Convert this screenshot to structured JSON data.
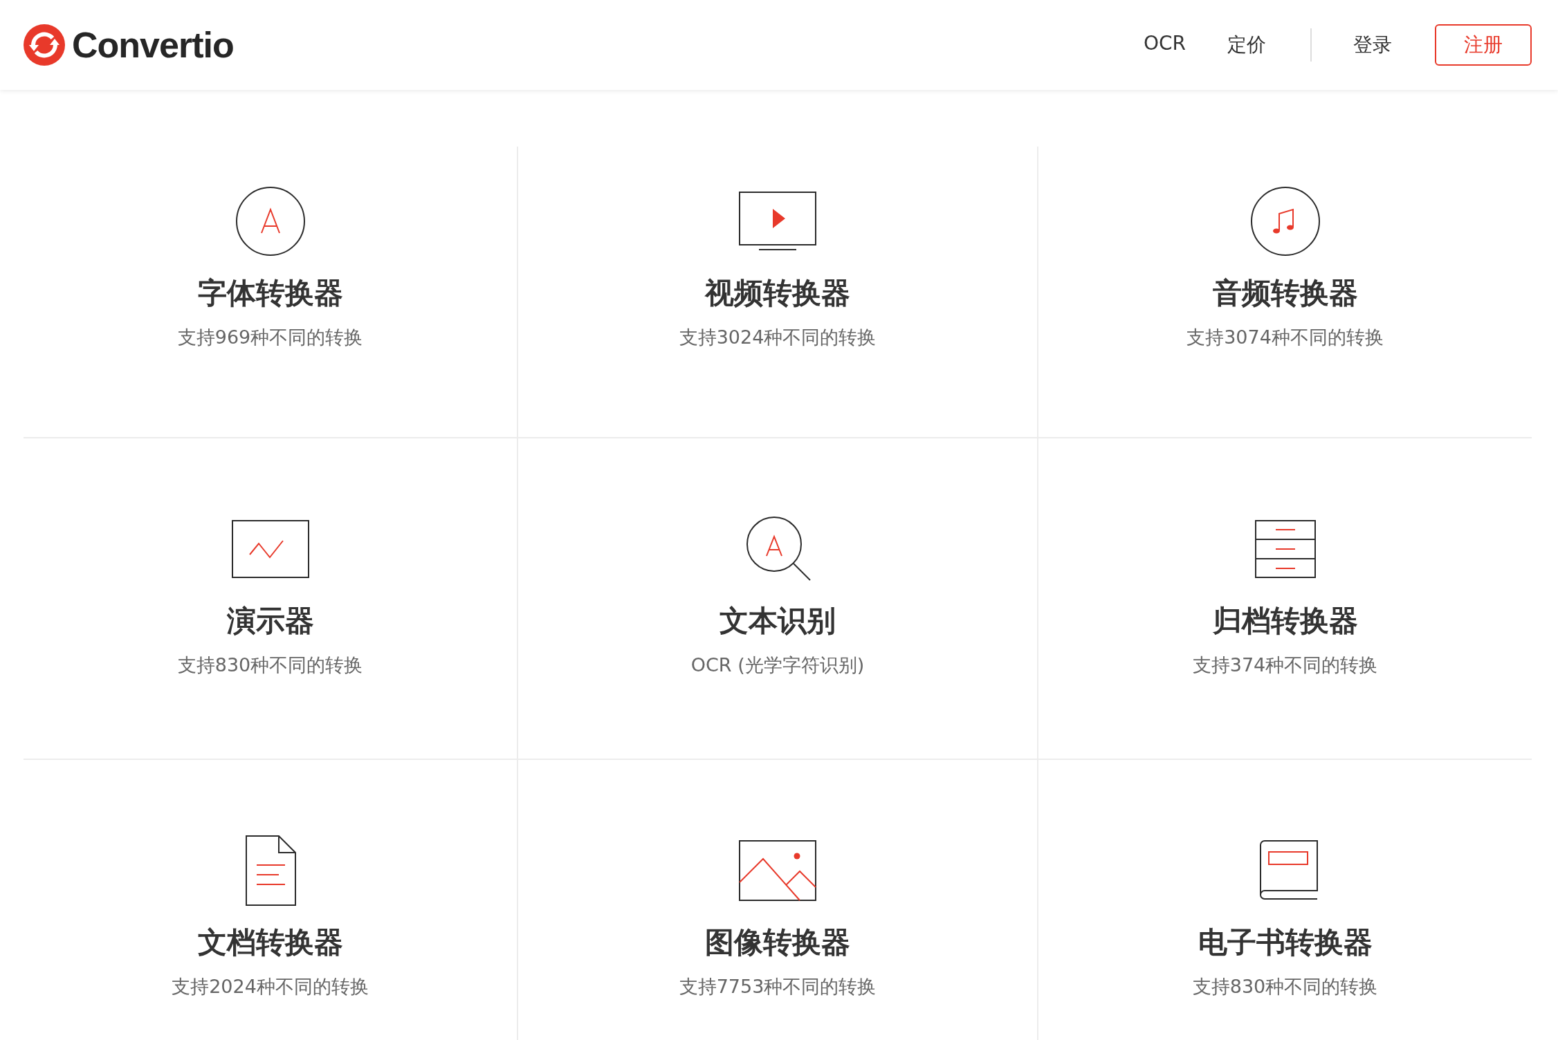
{
  "header": {
    "logo": "Convertio",
    "nav": [
      {
        "label": "OCR"
      },
      {
        "label": "定价"
      }
    ],
    "login": "登录",
    "signup": "注册"
  },
  "converters": [
    {
      "kind": "font",
      "title": "字体转换器",
      "subtitle": "支持969种不同的转换"
    },
    {
      "kind": "video",
      "title": "视频转换器",
      "subtitle": "支持3024种不同的转换"
    },
    {
      "kind": "audio",
      "title": "音频转换器",
      "subtitle": "支持3074种不同的转换"
    },
    {
      "kind": "presentation",
      "title": "演示器",
      "subtitle": "支持830种不同的转换"
    },
    {
      "kind": "ocr",
      "title": "文本识别",
      "subtitle": "OCR (光学字符识别)"
    },
    {
      "kind": "archive",
      "title": "归档转换器",
      "subtitle": "支持374种不同的转换"
    },
    {
      "kind": "document",
      "title": "文档转换器",
      "subtitle": "支持2024种不同的转换"
    },
    {
      "kind": "image",
      "title": "图像转换器",
      "subtitle": "支持7753种不同的转换"
    },
    {
      "kind": "ebook",
      "title": "电子书转换器",
      "subtitle": "支持830种不同的转换"
    }
  ]
}
